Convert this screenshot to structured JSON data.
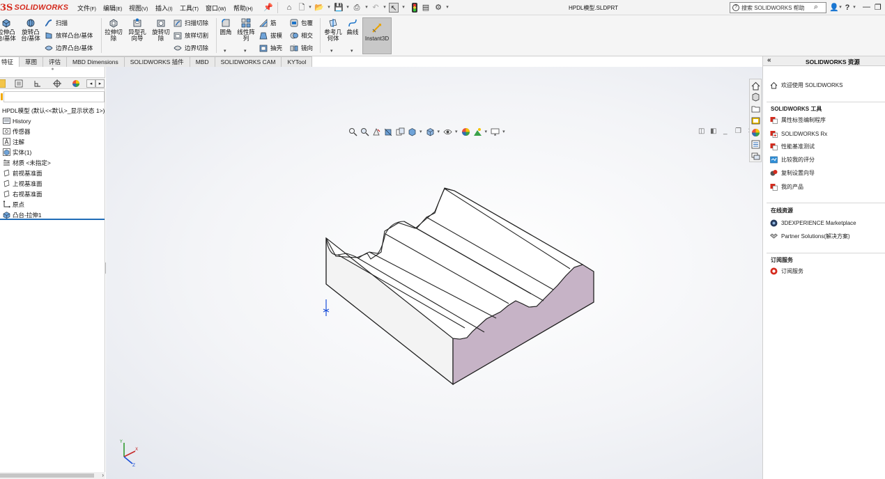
{
  "app": {
    "logo_prefix": "3S",
    "logo_text": "SOLIDWORKS",
    "document_title": "HPDL模型.SLDPRT"
  },
  "menubar": {
    "items": [
      {
        "label": "文件",
        "accel": "(F)"
      },
      {
        "label": "编辑",
        "accel": "(E)"
      },
      {
        "label": "视图",
        "accel": "(V)"
      },
      {
        "label": "插入",
        "accel": "(I)"
      },
      {
        "label": "工具",
        "accel": "(T)"
      },
      {
        "label": "窗口",
        "accel": "(W)"
      },
      {
        "label": "帮助",
        "accel": "(H)"
      }
    ],
    "search_placeholder": "搜索 SOLIDWORKS 帮助"
  },
  "commands": {
    "extrude_boss": "拉伸凸\n台/基体",
    "revolve_boss": "旋转凸\n台/基体",
    "sweep": "扫描",
    "loft_boss": "放样凸台/基体",
    "boundary_boss": "边界凸台/基体",
    "extrude_cut": "拉伸切\n除",
    "hole_wizard": "异型孔\n向导",
    "revolve_cut": "旋转切\n除",
    "swept_cut": "扫描切除",
    "lofted_cut": "放样切割",
    "boundary_cut": "边界切除",
    "fillet": "圆角",
    "linear_pattern": "线性阵\n列",
    "rib": "筋",
    "draft": "拔模",
    "shell": "抽壳",
    "wrap": "包覆",
    "intersect": "相交",
    "mirror": "镜向",
    "reference_geometry": "参考几\n何体",
    "curves": "曲线",
    "instant3d": "Instant3D"
  },
  "tabs": [
    {
      "label": "特征",
      "active": true
    },
    {
      "label": "草图",
      "active": false
    },
    {
      "label": "评估",
      "active": false
    },
    {
      "label": "MBD Dimensions",
      "active": false
    },
    {
      "label": "SOLIDWORKS 插件",
      "active": false
    },
    {
      "label": "MBD",
      "active": false
    },
    {
      "label": "SOLIDWORKS CAM",
      "active": false
    },
    {
      "label": "KYTool",
      "active": false
    }
  ],
  "feature_tree": {
    "root": "HPDL模型 (默认<<默认>_显示状态 1>)",
    "nodes": [
      {
        "label": "History",
        "icon": "history-icon"
      },
      {
        "label": "传感器",
        "icon": "sensor-icon"
      },
      {
        "label": "注解",
        "icon": "annotation-icon"
      },
      {
        "label": "实体(1)",
        "icon": "solid-bodies-icon"
      },
      {
        "label": "材质 <未指定>",
        "icon": "material-icon"
      },
      {
        "label": "前视基准面",
        "icon": "plane-icon"
      },
      {
        "label": "上视基准面",
        "icon": "plane-icon"
      },
      {
        "label": "右视基准面",
        "icon": "plane-icon"
      },
      {
        "label": "原点",
        "icon": "origin-icon"
      },
      {
        "label": "凸台-拉伸1",
        "icon": "boss-extrude-icon"
      }
    ]
  },
  "task_pane": {
    "title": "SOLIDWORKS 资源",
    "welcome": "欢迎使用 SOLIDWORKS",
    "tools_section": "SOLIDWORKS 工具",
    "tools": [
      "属性标签编制程序",
      "SOLIDWORKS Rx",
      "性能基准测试",
      "比较我的评分",
      "复制设置向导",
      "我的产品"
    ],
    "online_section": "在线资源",
    "online": [
      "3DEXPERIENCE Marketplace",
      "Partner Solutions(解决方案)"
    ],
    "subscription_section": "订阅服务",
    "subscription": [
      "订阅服务"
    ]
  },
  "colors": {
    "accent_red": "#d52b1e",
    "selection_blue": "#1f6cb7",
    "model_face_top": "#ffffff",
    "model_face_front": "#f1f1f1",
    "model_face_side": "#c8b4c8"
  }
}
